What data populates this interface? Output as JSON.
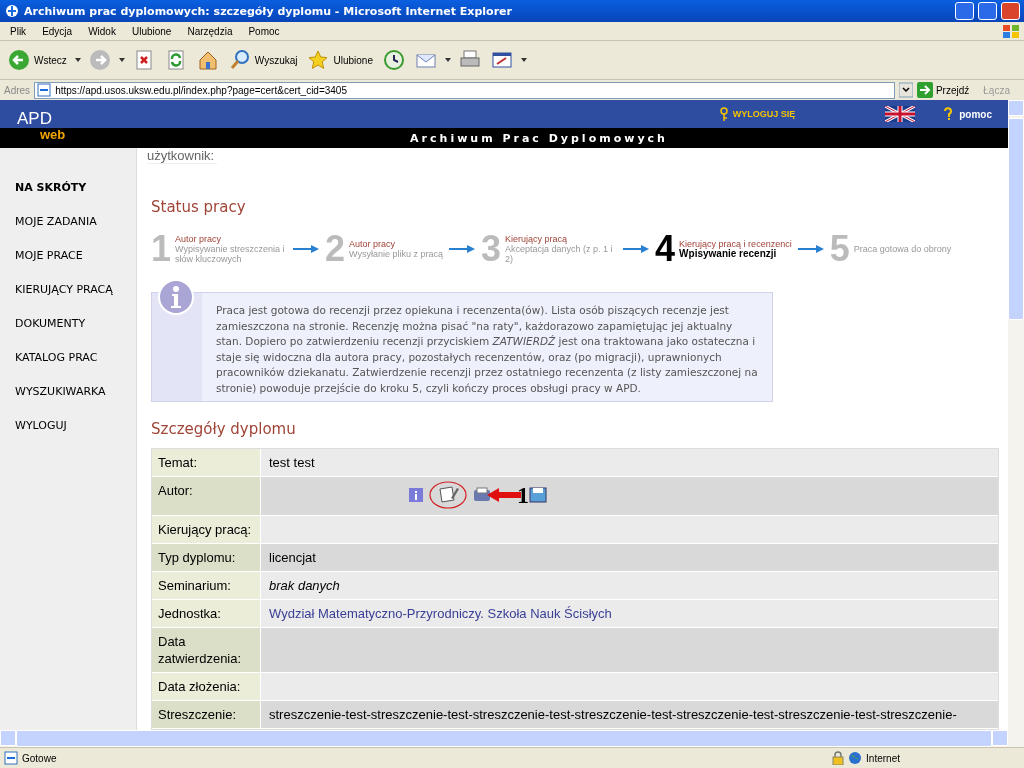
{
  "window": {
    "title": "Archiwum prac dyplomowych: szczegóły dyplomu - Microsoft Internet Explorer"
  },
  "menu": [
    "Plik",
    "Edycja",
    "Widok",
    "Ulubione",
    "Narzędzia",
    "Pomoc"
  ],
  "toolbar": [
    {
      "kind": "back",
      "label": "Wstecz",
      "dropdown": true
    },
    {
      "kind": "forward",
      "dropdown": true
    },
    {
      "kind": "stop"
    },
    {
      "kind": "refresh"
    },
    {
      "kind": "home"
    },
    {
      "kind": "search",
      "label": "Wyszukaj"
    },
    {
      "kind": "favorites",
      "label": "Ulubione"
    },
    {
      "kind": "history"
    },
    {
      "kind": "mail",
      "dropdown": true
    },
    {
      "kind": "print"
    },
    {
      "kind": "edit",
      "dropdown": true
    }
  ],
  "address": {
    "label": "Adres",
    "value": "https://apd.usos.uksw.edu.pl/index.php?page=cert&cert_cid=3405",
    "go": "Przejdź",
    "links": "Łącza"
  },
  "header": {
    "logo_main": "APD",
    "logo_sub": "web",
    "logout": "WYLOGUJ SIĘ",
    "help": "pomoc",
    "banner": "Archiwum Prac Dyplomowych"
  },
  "sidebar": {
    "items": [
      {
        "label": "NA SKRÓTY",
        "selected": true
      },
      {
        "label": "MOJE ZADANIA",
        "selected": false
      },
      {
        "label": "MOJE PRACE",
        "selected": false
      },
      {
        "label": "KIERUJĄCY PRACĄ",
        "selected": false
      },
      {
        "label": "DOKUMENTY",
        "selected": false
      },
      {
        "label": "KATALOG PRAC",
        "selected": false
      },
      {
        "label": "WYSZUKIWARKA",
        "selected": false
      },
      {
        "label": "WYLOGUJ",
        "selected": false
      }
    ]
  },
  "user_label": "użytkownik:",
  "status_section": {
    "title": "Status pracy",
    "steps": [
      {
        "number": "1",
        "actor": "Autor pracy",
        "task": "Wypisywanie streszczenia i słów kluczowych",
        "current": false
      },
      {
        "number": "2",
        "actor": "Autor pracy",
        "task": "Wysyłanie pliku z pracą",
        "current": false
      },
      {
        "number": "3",
        "actor": "Kierujący pracą",
        "task": "Akceptacja danych (z p. 1 i 2)",
        "current": false
      },
      {
        "number": "4",
        "actor": "Kierujący pracą i recenzenci",
        "task": "Wpisywanie recenzji",
        "current": true
      },
      {
        "number": "5",
        "task": "Praca gotowa do obrony",
        "current": false
      }
    ]
  },
  "info": {
    "text": "Praca jest gotowa do recenzji przez opiekuna i recenzenta(ów). Lista osób piszących recenzje jest zamieszczona na stronie. Recenzję można pisać \"na raty\", każdorazowo zapamiętując jej aktualny stan. Dopiero po zatwierdzeniu recenzji przyciskiem *ZATWIERDŹ* jest ona traktowana jako ostateczna i staje się widoczna dla autora pracy, pozostałych recenzentów, oraz (po migracji), uprawnionych pracowników dziekanatu. Zatwierdzenie recenzji przez ostatniego recenzenta (z listy zamieszczonej na stronie) powoduje przejście do kroku 5, czyli kończy proces obsługi pracy w APD."
  },
  "details": {
    "title": "Szczegóły dyplomu",
    "rows": [
      {
        "label": "Temat:",
        "value": "test test",
        "kind": "text",
        "shaded": false
      },
      {
        "label": "Autor:",
        "kind": "icons",
        "annotation": "1",
        "shaded": true
      },
      {
        "label": "Kierujący pracą:",
        "kind": "text",
        "shaded": false
      },
      {
        "label": "Typ dyplomu:",
        "value": "licencjat",
        "kind": "text",
        "shaded": true
      },
      {
        "label": "Seminarium:",
        "value": "brak danych",
        "kind": "italic",
        "shaded": false
      },
      {
        "label": "Jednostka:",
        "value": "Wydział Matematyczno-Przyrodniczy. Szkoła Nauk Ścisłych",
        "kind": "link",
        "shaded": false
      },
      {
        "label": "Data zatwierdzenia:",
        "kind": "text",
        "shaded": true
      },
      {
        "label": "Data złożenia:",
        "kind": "text",
        "shaded": false
      },
      {
        "label": "Streszczenie:",
        "value": "streszczenie-test-streszczenie-test-streszczenie-test-streszczenie-test-streszczenie-test-streszczenie-test-streszczenie-",
        "kind": "text",
        "shaded": true
      }
    ]
  },
  "status_bar": {
    "text": "Gotowe",
    "zone": "Internet"
  }
}
